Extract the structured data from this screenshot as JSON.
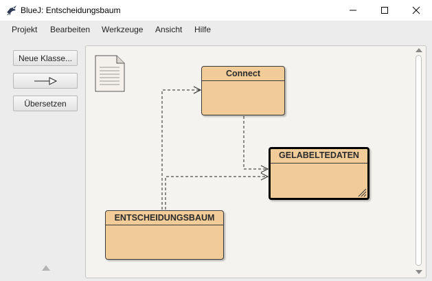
{
  "window": {
    "app_name": "BlueJ:",
    "project_name": "Entscheidungsbaum",
    "controls": {
      "minimize": "—",
      "maximize": "☐",
      "close": "✕"
    }
  },
  "menu": {
    "items": [
      {
        "label": "Projekt"
      },
      {
        "label": "Bearbeiten"
      },
      {
        "label": "Werkzeuge"
      },
      {
        "label": "Ansicht"
      },
      {
        "label": "Hilfe"
      }
    ]
  },
  "sidebar": {
    "new_class_label": "Neue Klasse...",
    "compile_label": "Übersetzen"
  },
  "diagram": {
    "classes": [
      {
        "name": "Connect",
        "selected": false
      },
      {
        "name": "GELABELTEDATEN",
        "selected": true
      },
      {
        "name": "ENTSCHEIDUNGSBAUM",
        "selected": false
      }
    ]
  },
  "colors": {
    "class_fill": "#f1cc99",
    "canvas_bg": "#f5f3ef",
    "panel_bg": "#ececec"
  }
}
